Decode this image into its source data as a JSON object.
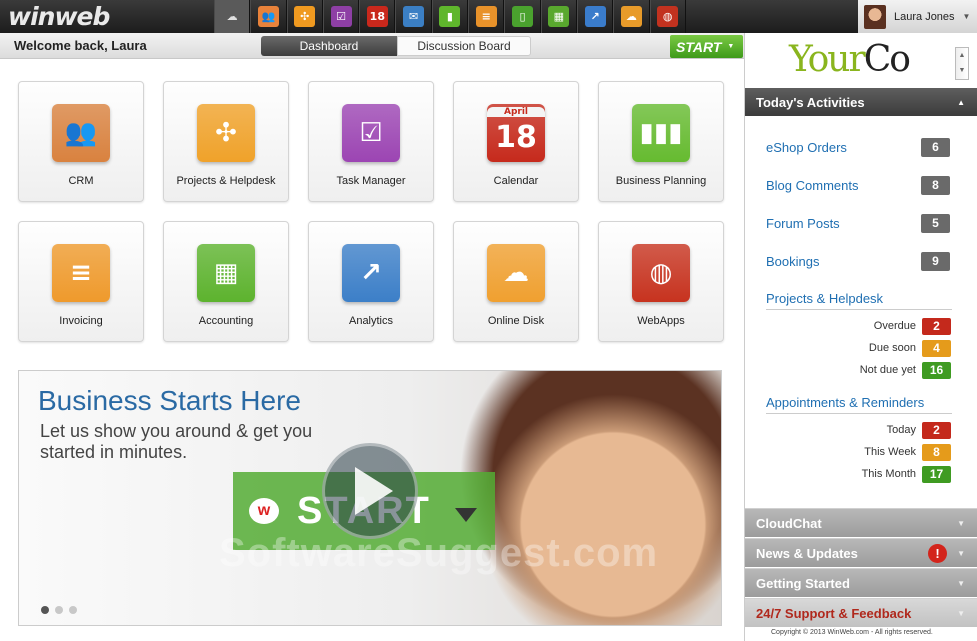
{
  "topbar": {
    "logo": "winweb",
    "apps": [
      {
        "name": "online-disk",
        "glyph": "☁",
        "color": "#e0e0e0",
        "active": true
      },
      {
        "name": "crm",
        "glyph": "👥",
        "color": "#e8823a"
      },
      {
        "name": "projects",
        "glyph": "✣",
        "color": "#f09a20"
      },
      {
        "name": "tasks",
        "glyph": "☑",
        "color": "#8e3fa5"
      },
      {
        "name": "calendar",
        "glyph": "18",
        "color": "#c9281c"
      },
      {
        "name": "mail",
        "glyph": "✉",
        "color": "#3b7fc4"
      },
      {
        "name": "business-planning",
        "glyph": "▮",
        "color": "#5fb62c"
      },
      {
        "name": "invoicing",
        "glyph": "≡",
        "color": "#e8922a"
      },
      {
        "name": "contacts",
        "glyph": "▯",
        "color": "#4aa22e"
      },
      {
        "name": "accounting",
        "glyph": "▦",
        "color": "#59a82e"
      },
      {
        "name": "analytics",
        "glyph": "↗",
        "color": "#3a7ccb"
      },
      {
        "name": "disk",
        "glyph": "☁",
        "color": "#e89b2a"
      },
      {
        "name": "webapps",
        "glyph": "◍",
        "color": "#c2321f"
      }
    ],
    "user_name": "Laura Jones"
  },
  "subbar": {
    "welcome": "Welcome back, Laura",
    "tab_dashboard": "Dashboard",
    "tab_discussion": "Discussion Board",
    "start_label": "START"
  },
  "tiles": [
    {
      "label": "CRM",
      "glyph": "👥",
      "color": "#d9823f",
      "icon": "crm-icon"
    },
    {
      "label": "Projects & Helpdesk",
      "glyph": "✣",
      "color": "#f0a22a",
      "icon": "projects-icon"
    },
    {
      "label": "Task Manager",
      "glyph": "☑",
      "color": "#9c45b3",
      "icon": "task-icon"
    },
    {
      "label": "Calendar",
      "glyph": "18",
      "color": "#c62a1c",
      "icon": "calendar-icon"
    },
    {
      "label": "Business Planning",
      "glyph": "▮▮▮",
      "color": "#66bb30",
      "icon": "chart-icon"
    },
    {
      "label": "Invoicing",
      "glyph": "≡",
      "color": "#ef9a2c",
      "icon": "invoice-icon"
    },
    {
      "label": "Accounting",
      "glyph": "▦",
      "color": "#5db32e",
      "icon": "spreadsheet-icon"
    },
    {
      "label": "Analytics",
      "glyph": "↗",
      "color": "#3c7fc8",
      "icon": "analytics-icon"
    },
    {
      "label": "Online Disk",
      "glyph": "☁",
      "color": "#f0a030",
      "icon": "cloud-icon"
    },
    {
      "label": "WebApps",
      "glyph": "◍",
      "color": "#c7331f",
      "icon": "globe-icon"
    }
  ],
  "calendar_month": "April",
  "hero": {
    "title": "Business Starts Here",
    "subtitle": "Let us show you around & get you started in minutes.",
    "banner_text": "START",
    "banner_logo": "w",
    "watermark": "SoftwareSuggest.com"
  },
  "sidebar": {
    "brand_your": "Your",
    "brand_co": "Co",
    "activities_title": "Today's Activities",
    "activities": [
      {
        "label": "eShop Orders",
        "count": "6"
      },
      {
        "label": "Blog Comments",
        "count": "8"
      },
      {
        "label": "Forum Posts",
        "count": "5"
      },
      {
        "label": "Bookings",
        "count": "9"
      }
    ],
    "projects_title": "Projects & Helpdesk",
    "projects": [
      {
        "label": "Overdue",
        "count": "2",
        "tone": "red"
      },
      {
        "label": "Due soon",
        "count": "4",
        "tone": "orange"
      },
      {
        "label": "Not due yet",
        "count": "16",
        "tone": "green"
      }
    ],
    "appointments_title": "Appointments & Reminders",
    "appointments": [
      {
        "label": "Today",
        "count": "2",
        "tone": "red"
      },
      {
        "label": "This Week",
        "count": "8",
        "tone": "orange"
      },
      {
        "label": "This Month",
        "count": "17",
        "tone": "green"
      }
    ],
    "cloudchat": "CloudChat",
    "news": "News & Updates",
    "getting_started": "Getting Started",
    "support": "24/7 Support & Feedback",
    "alert_glyph": "!",
    "copyright": "Copyright © 2013 WinWeb.com - All rights reserved."
  }
}
